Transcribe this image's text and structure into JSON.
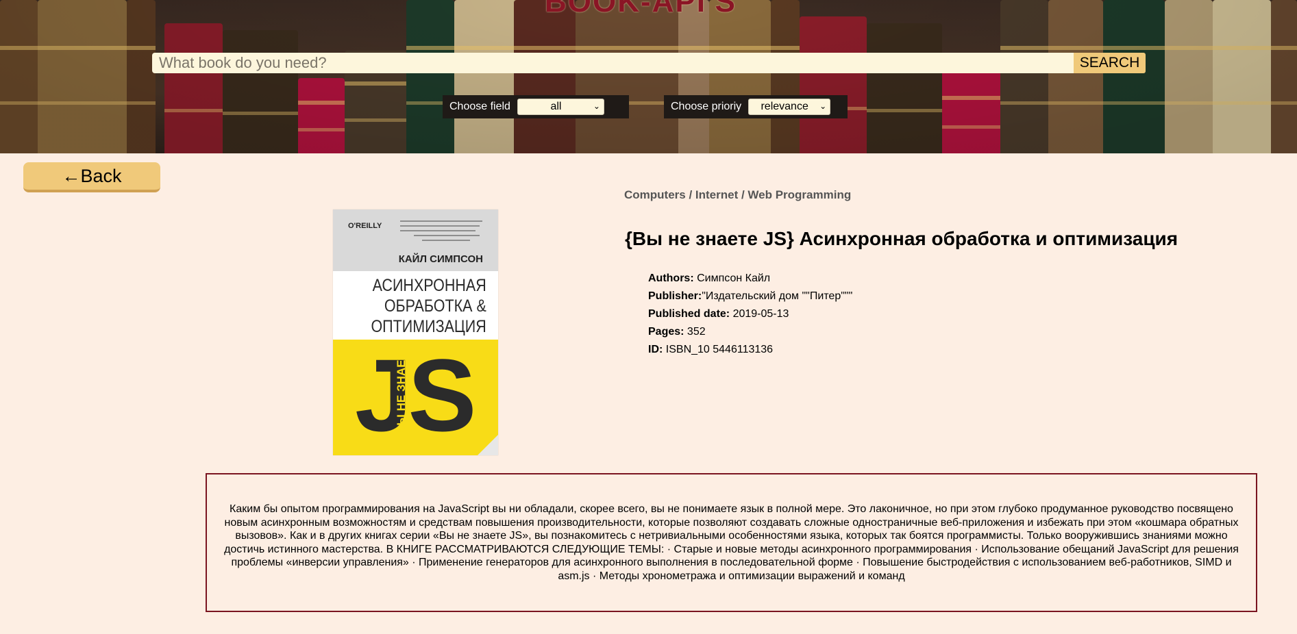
{
  "header": {
    "site_title": "BOOK-API'S",
    "search_placeholder": "What book do you need?",
    "search_button_label": "SEARCH",
    "field_filter": {
      "label": "Choose field",
      "selected": "all"
    },
    "priority_filter": {
      "label": "Choose prioriy",
      "selected": "relevance"
    }
  },
  "back_button_label": "←Back",
  "book": {
    "categories": "Computers / Internet / Web Programming",
    "title": "{Вы не знаете JS} Асинхронная обработка и оптимизация",
    "meta": [
      {
        "key": "Authors:",
        "value": " Симпсон Кайл"
      },
      {
        "key": "Publisher:",
        "value": "\"Издательский дом \"\"Питер\"\"\""
      },
      {
        "key": "Published date:",
        "value": " 2019-05-13"
      },
      {
        "key": "Pages:",
        "value": " 352"
      },
      {
        "key": "ID:",
        "value": " ISBN_10 5446113136"
      }
    ],
    "cover": {
      "publisher": "O'REILLY",
      "author": "КАЙЛ СИМПСОН",
      "title_lines": [
        "АСИНХРОННАЯ",
        "ОБРАБОТКА &",
        "ОПТИМИЗАЦИЯ"
      ],
      "big_text": "JS",
      "vertical_text": "ВЫ НЕ ЗНАЕТЕ",
      "colors": {
        "top": "#d9d9d9",
        "bottom": "#f8dc17"
      }
    },
    "description": "Каким бы опытом программирования на JavaScript вы ни обладали, скорее всего, вы не понимаете язык в полной мере. Это лаконичное, но при этом глубоко продуманное руководство посвящено новым асинхронным возможностям и средствам повышения производительности, которые позволяют создавать сложные одностраничные веб-приложения и избежать при этом «кошмара обратных вызовов». Как и в других книгах серии «Вы не знаете JS», вы познакомитесь с нетривиальными особенностями языка, которых так боятся программисты. Только вооружившись знаниями можно достичь истинного мастерства. В КНИГЕ РАССМАТРИВАЮТСЯ СЛЕДУЮЩИЕ ТЕМЫ: · Старые и новые методы асинхронного программирования · Использование обещаний JavaScript для решения проблемы «инверсии управления» · Применение генераторов для асинхронного выполнения в последовательной форме · Повышение быстродействия с использованием веб-работников, SIMD и asm.js · Методы хронометража и оптимизации выражений и команд"
  },
  "colors": {
    "page_bg": "#fdeee3",
    "accent_button": "#f0c97a",
    "description_border": "#7a1420",
    "title_red": "#8a1525"
  }
}
